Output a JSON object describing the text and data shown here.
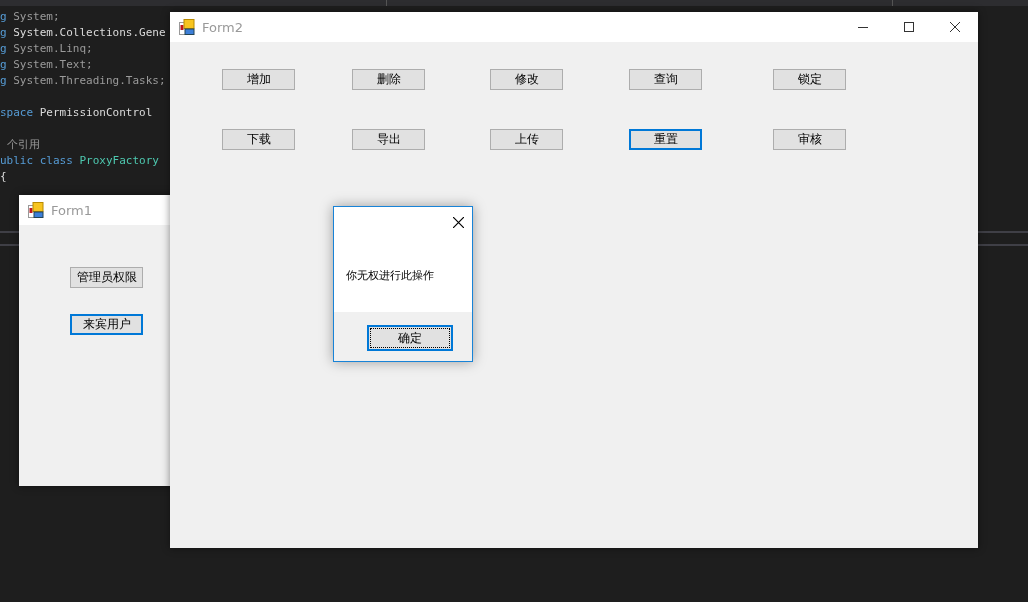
{
  "code_editor": {
    "blocks": [
      {
        "lines": [
          {
            "tokens": [
              {
                "text": "g",
                "kind": "keyword"
              },
              {
                "text": " System;",
                "kind": "dim"
              }
            ]
          },
          {
            "tokens": [
              {
                "text": "g",
                "kind": "keyword"
              },
              {
                "text": " System.Collections.Gene",
                "kind": "plain"
              }
            ]
          },
          {
            "tokens": [
              {
                "text": "g",
                "kind": "keyword"
              },
              {
                "text": " System.Linq;",
                "kind": "dim"
              }
            ]
          },
          {
            "tokens": [
              {
                "text": "g",
                "kind": "keyword"
              },
              {
                "text": " System.Text;",
                "kind": "dim"
              }
            ]
          },
          {
            "tokens": [
              {
                "text": "g",
                "kind": "keyword"
              },
              {
                "text": " System.Threading.Tasks;",
                "kind": "dim"
              }
            ]
          }
        ]
      },
      {
        "lines": [
          {
            "tokens": [
              {
                "text": "space",
                "kind": "keyword"
              },
              {
                "text": " PermissionControl",
                "kind": "plain"
              }
            ]
          }
        ]
      },
      {
        "lines": [
          {
            "tokens": [
              {
                "text": " 个引用",
                "kind": "dim"
              }
            ]
          },
          {
            "tokens": [
              {
                "text": "ublic class",
                "kind": "keyword"
              },
              {
                "text": " ProxyFactory",
                "kind": "type"
              }
            ]
          },
          {
            "tokens": [
              {
                "text": "{",
                "kind": "plain"
              }
            ]
          }
        ]
      }
    ]
  },
  "form1": {
    "title": "Form1",
    "buttons": [
      {
        "label": "管理员权限",
        "focused": false
      },
      {
        "label": "来宾用户",
        "focused": true
      }
    ]
  },
  "form2": {
    "title": "Form2",
    "buttons": [
      {
        "label": "增加",
        "focused": false
      },
      {
        "label": "删除",
        "focused": false
      },
      {
        "label": "修改",
        "focused": false
      },
      {
        "label": "查询",
        "focused": false
      },
      {
        "label": "锁定",
        "focused": false
      },
      {
        "label": "下载",
        "focused": false
      },
      {
        "label": "导出",
        "focused": false
      },
      {
        "label": "上传",
        "focused": false
      },
      {
        "label": "重置",
        "focused": true
      },
      {
        "label": "审核",
        "focused": false
      }
    ]
  },
  "message_box": {
    "message": "你无权进行此操作",
    "button": {
      "label": "确定",
      "focused": true
    }
  }
}
